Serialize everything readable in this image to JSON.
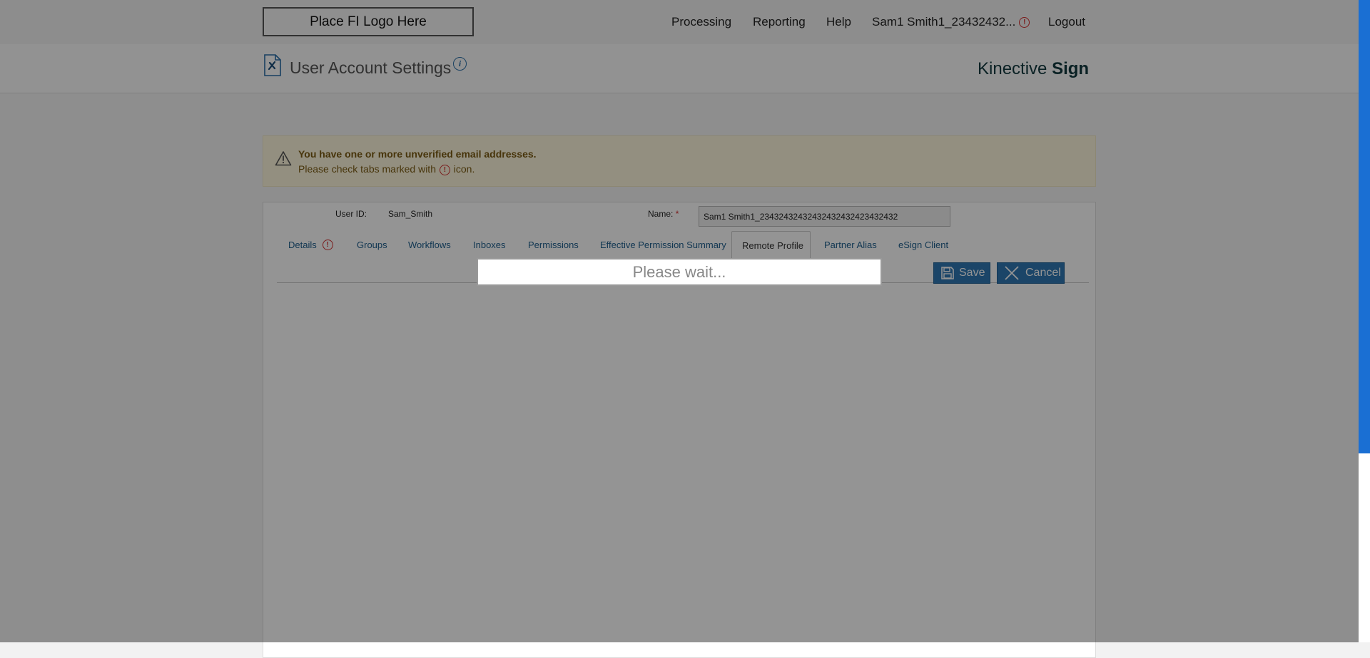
{
  "header": {
    "logo_text": "Place FI Logo Here",
    "nav": {
      "processing": "Processing",
      "reporting": "Reporting",
      "help": "Help",
      "user": "Sam1 Smith1_23432432...",
      "logout": "Logout"
    }
  },
  "page": {
    "title": "User Account Settings",
    "info_glyph": "i",
    "brand_prefix": "Kinective",
    "brand_suffix": "Sign"
  },
  "alert": {
    "title": "You have one or more unverified email addresses.",
    "text_before": "Please check tabs marked with",
    "text_after": "icon."
  },
  "form": {
    "user_id_label": "User ID:",
    "user_id_value": "Sam_Smith",
    "name_label": "Name:",
    "required_mark": "*",
    "name_value": "Sam1 Smith1_23432432432432432432423432432"
  },
  "tabs": [
    {
      "label": "Details"
    },
    {
      "label": "Groups"
    },
    {
      "label": "Workflows"
    },
    {
      "label": "Inboxes"
    },
    {
      "label": "Permissions"
    },
    {
      "label": "Effective Permission Summary"
    },
    {
      "label": "Remote Profile"
    },
    {
      "label": "Partner Alias"
    },
    {
      "label": "eSign Client"
    }
  ],
  "actions": {
    "save": "Save",
    "cancel": "Cancel"
  },
  "overlay": {
    "message": "Please wait..."
  },
  "colors": {
    "accent": "#2f78b3",
    "warning": "#d32f2f",
    "scrollbar": "#1a6fd3"
  }
}
